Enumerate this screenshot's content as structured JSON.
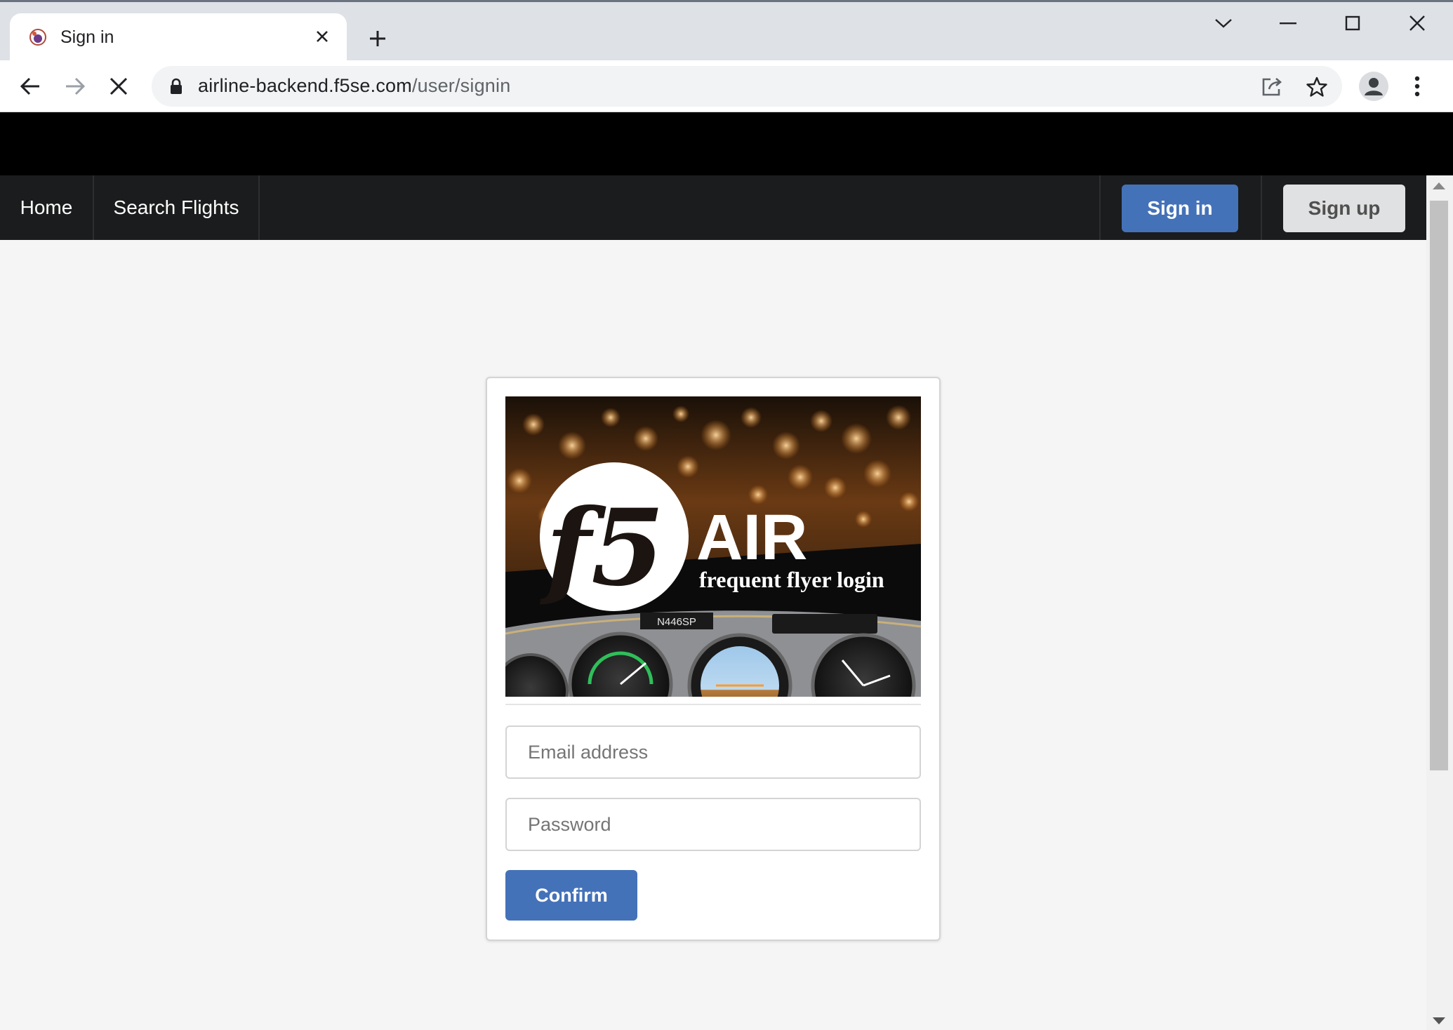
{
  "browser": {
    "tab_title": "Sign in",
    "url_host": "airline-backend.f5se.com",
    "url_path": "/user/signin"
  },
  "nav": {
    "home": "Home",
    "search_flights": "Search Flights",
    "sign_in": "Sign in",
    "sign_up": "Sign up"
  },
  "login": {
    "logo_brand": "f5",
    "logo_title": "AIR",
    "logo_subtitle": "frequent flyer login",
    "tail_number": "N446SP",
    "email_placeholder": "Email address",
    "password_placeholder": "Password",
    "confirm_label": "Confirm"
  },
  "colors": {
    "primary_button": "#4472b8",
    "navbar_bg": "#1b1c1d",
    "secondary_button": "#e0e1e2"
  }
}
